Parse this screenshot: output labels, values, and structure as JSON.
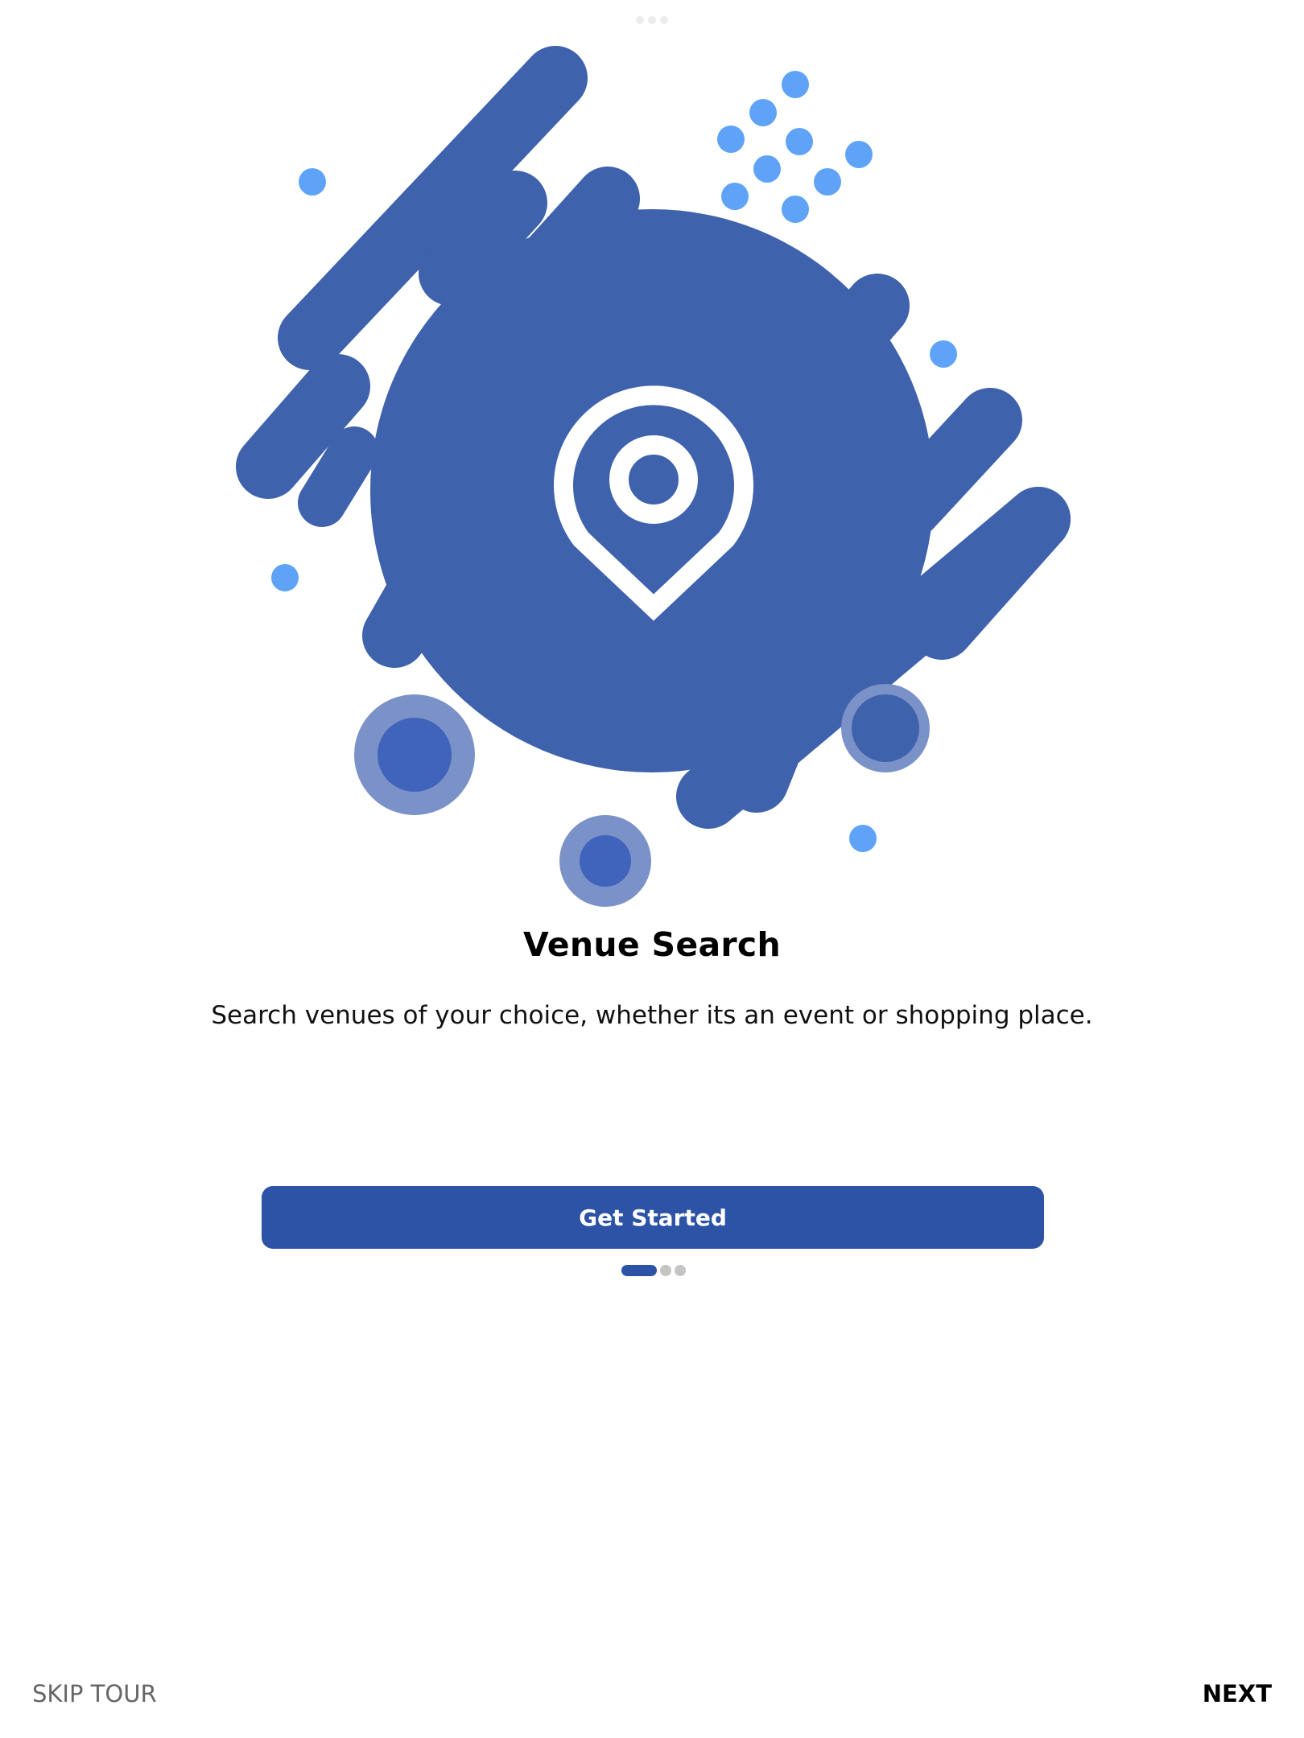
{
  "onboarding": {
    "title": "Venue Search",
    "description": "Search venues of your choice, whether its an event or shopping place.",
    "cta_label": "Get Started",
    "pager": {
      "total_pages": 3,
      "current_page": 1
    },
    "illustration_icon": "map-pin-icon"
  },
  "footer": {
    "skip_label": "SKIP TOUR",
    "next_label": "NEXT"
  },
  "colors": {
    "primary": "#2d53a6",
    "illustration_blue": "#3f62ad",
    "accent_dot": "#5ea3f8",
    "ring_light": "#7b92c8",
    "ring_core": "#4063bb",
    "inactive_dot": "#c4c4c4"
  }
}
